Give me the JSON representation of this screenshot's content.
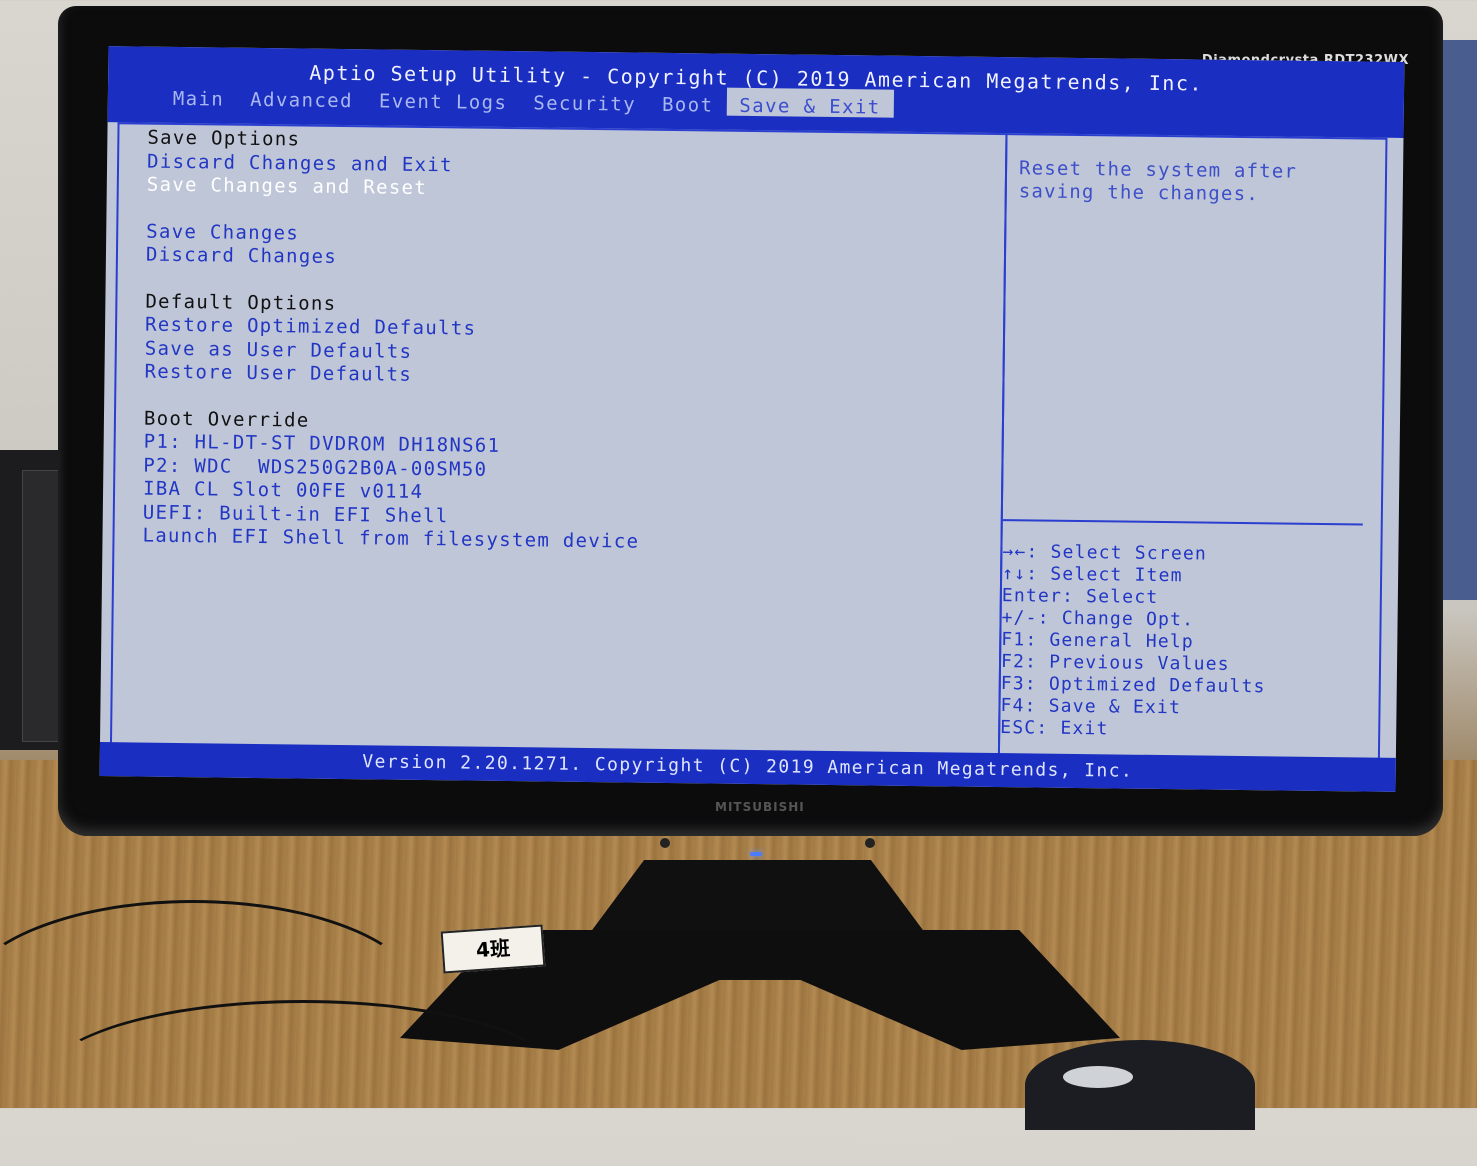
{
  "bios": {
    "title": "Aptio Setup Utility - Copyright (C) 2019 American Megatrends, Inc.",
    "tabs": [
      {
        "label": "Main"
      },
      {
        "label": "Advanced"
      },
      {
        "label": "Event Logs"
      },
      {
        "label": "Security"
      },
      {
        "label": "Boot"
      },
      {
        "label": "Save & Exit"
      }
    ],
    "active_tab": "Save & Exit",
    "menu": [
      {
        "label": "Save Options",
        "kind": "header"
      },
      {
        "label": "Discard Changes and Exit",
        "kind": "item"
      },
      {
        "label": "Save Changes and Reset",
        "kind": "selected"
      },
      {
        "label": "",
        "kind": "gap"
      },
      {
        "label": "Save Changes",
        "kind": "item"
      },
      {
        "label": "Discard Changes",
        "kind": "item"
      },
      {
        "label": "",
        "kind": "gap"
      },
      {
        "label": "Default Options",
        "kind": "header"
      },
      {
        "label": "Restore Optimized Defaults",
        "kind": "item"
      },
      {
        "label": "Save as User Defaults",
        "kind": "item"
      },
      {
        "label": "Restore User Defaults",
        "kind": "item"
      },
      {
        "label": "",
        "kind": "gap"
      },
      {
        "label": "Boot Override",
        "kind": "header"
      },
      {
        "label": "P1: HL-DT-ST DVDROM DH18NS61",
        "kind": "item"
      },
      {
        "label": "P2: WDC  WDS250G2B0A-00SM50",
        "kind": "item"
      },
      {
        "label": "IBA CL Slot 00FE v0114",
        "kind": "item"
      },
      {
        "label": "UEFI: Built-in EFI Shell",
        "kind": "item"
      },
      {
        "label": "Launch EFI Shell from filesystem device",
        "kind": "item"
      }
    ],
    "help_lines": [
      "Reset the system after",
      "saving the changes."
    ],
    "key_help": [
      "→←: Select Screen",
      "↑↓: Select Item",
      "Enter: Select",
      "+/-: Change Opt.",
      "F1: General Help",
      "F2: Previous Values",
      "F3: Optimized Defaults",
      "F4: Save & Exit",
      "ESC: Exit"
    ],
    "version": "Version 2.20.1271. Copyright (C) 2019 American Megatrends, Inc."
  },
  "monitor": {
    "model": "Diamondcrysta RDT232WX",
    "maker": "MITSUBISHI"
  },
  "sticker": "4班",
  "colors": {
    "bios_blue": "#1a2ec2",
    "bios_bg": "#bfc6d8",
    "item_text": "#2236c4",
    "selected_text": "#ffffff"
  }
}
